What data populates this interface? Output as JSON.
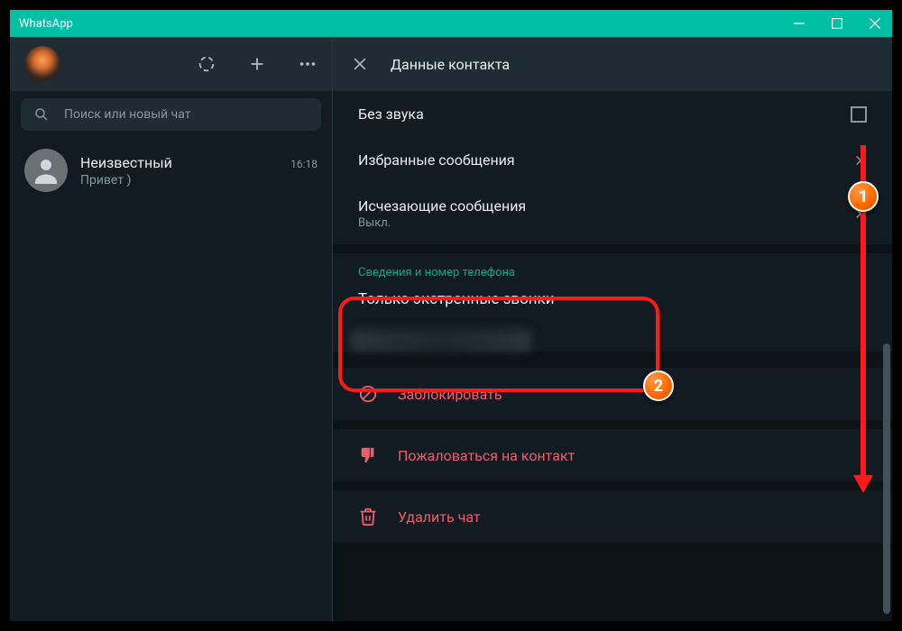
{
  "window": {
    "title": "WhatsApp"
  },
  "left": {
    "search_placeholder": "Поиск или новый чат",
    "chats": [
      {
        "name": "Неизвестный",
        "preview": "Привет )",
        "time": "16:18"
      }
    ]
  },
  "right": {
    "header": "Данные контакта",
    "mute_label": "Без звука",
    "starred_label": "Избранные сообщения",
    "disappearing_label": "Исчезающие сообщения",
    "disappearing_value": "Выкл.",
    "info_section_label": "Сведения и номер телефона",
    "info_value": "Только экстренные звонки",
    "block_label": "Заблокировать",
    "report_label": "Пожаловаться на контакт",
    "delete_label": "Удалить чат"
  },
  "annotations": {
    "badge1": "1",
    "badge2": "2"
  }
}
